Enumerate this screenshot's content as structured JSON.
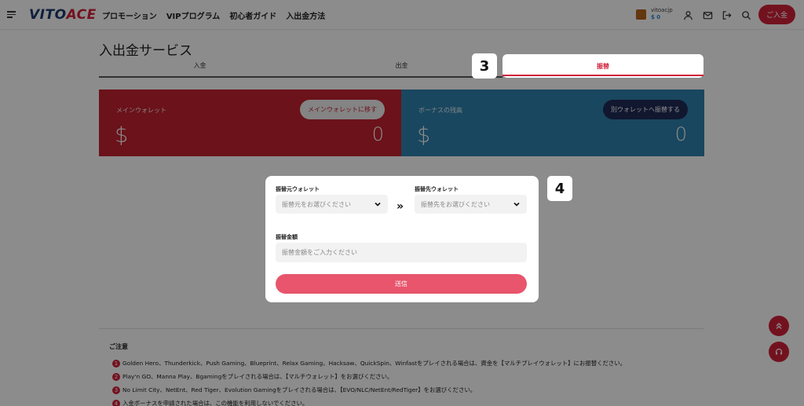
{
  "header": {
    "logo": "VITOACE",
    "nav": [
      "プロモーション",
      "VIPプログラム",
      "初心者ガイド",
      "入出金方法"
    ],
    "user": {
      "name": "vitoacjp",
      "balance": "$ 0"
    },
    "deposit_label": "ご入金"
  },
  "page": {
    "title": "入出金サービス",
    "tabs": [
      "入金",
      "出金",
      "振替"
    ],
    "active_tab": "振替",
    "step_badges": [
      "3",
      "4"
    ]
  },
  "wallets": {
    "main": {
      "label": "メインウォレット",
      "currency": "$",
      "amount": "0",
      "button": "メインウォレットに移す",
      "color": "#c42231"
    },
    "bonus": {
      "label": "ボーナスの残高",
      "currency": "$",
      "amount": "0",
      "button": "別ウォレットへ振替する",
      "color": "#2f82ad"
    }
  },
  "transfer_form": {
    "from_label": "振替元ウォレット",
    "from_placeholder": "振替元をお選びください",
    "to_label": "振替先ウォレット",
    "to_placeholder": "振替先をお選びください",
    "arrows": "»",
    "amount_label": "振替金額",
    "amount_placeholder": "振替金額をご入力ください",
    "submit": "送信"
  },
  "notes": {
    "title": "ご注意",
    "items": [
      {
        "num": "1",
        "text": "Golden Hero、Thunderkick、Push Gaming、Blueprint、Relax Gaming、Hacksaw、QuickSpin、Winfastをプレイされる場合は、資金を【マルチプレイウォレット】にお振替ください。"
      },
      {
        "num": "2",
        "text": "Play'n GO、Manna Play、Bgamingをプレイされる場合は、【マルチウォレット】をお選びください。"
      },
      {
        "num": "3",
        "text": "No Limit City、NetEnt、Red Tiger、Evolution Gamingをプレイされる場合は、【EVO/NLC/NetEnt/RedTiger】をお選びください。"
      },
      {
        "num": "4",
        "text": "入金ボーナスを申請された場合は、この機能を利用しないでください。"
      }
    ]
  },
  "colors": {
    "brand_red": "#d1213a",
    "brand_blue": "#2f82ad",
    "navy": "#1f2a56"
  }
}
